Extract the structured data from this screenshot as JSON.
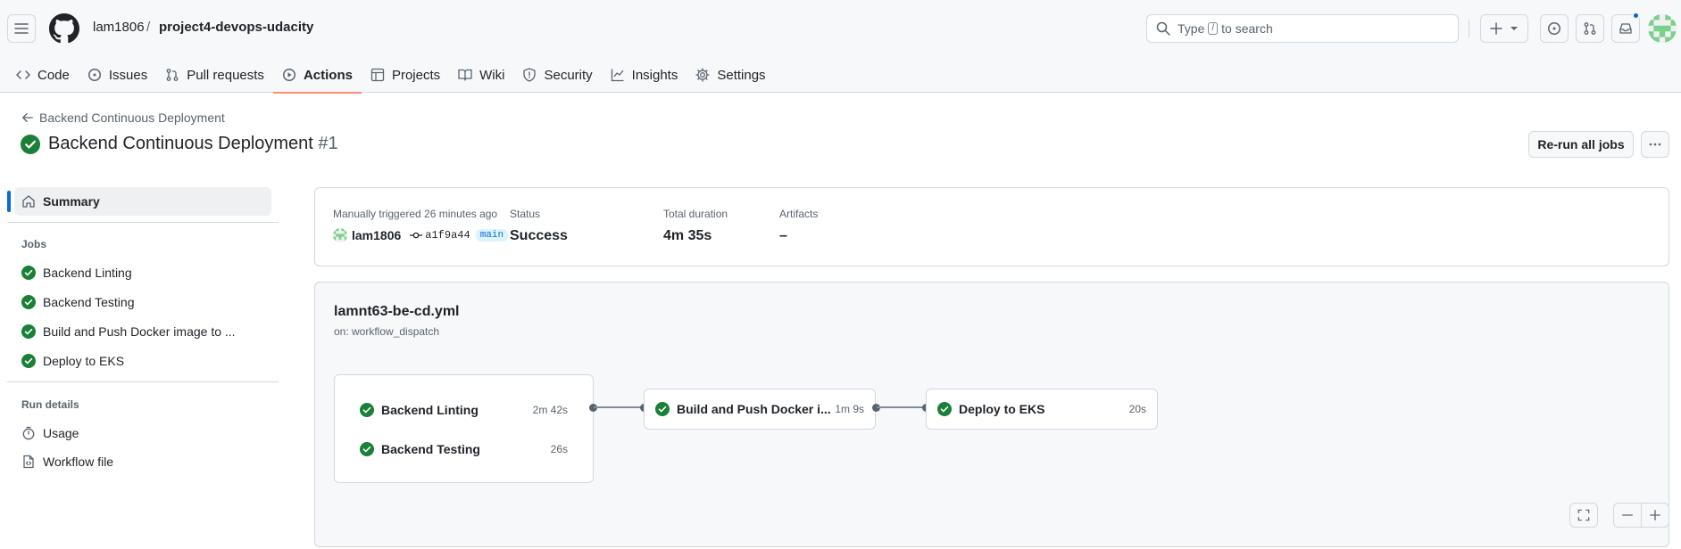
{
  "header": {
    "owner": "lam1806",
    "separator": "/",
    "repo": "project4-devops-udacity",
    "search_prefix": "Type",
    "search_key": "/",
    "search_suffix": "to search"
  },
  "tabs": [
    {
      "label": "Code",
      "icon": "code-icon"
    },
    {
      "label": "Issues",
      "icon": "issue-icon"
    },
    {
      "label": "Pull requests",
      "icon": "pull-request-icon"
    },
    {
      "label": "Actions",
      "icon": "play-icon",
      "active": true
    },
    {
      "label": "Projects",
      "icon": "table-icon"
    },
    {
      "label": "Wiki",
      "icon": "book-icon"
    },
    {
      "label": "Security",
      "icon": "shield-icon"
    },
    {
      "label": "Insights",
      "icon": "graph-icon"
    },
    {
      "label": "Settings",
      "icon": "gear-icon"
    }
  ],
  "run": {
    "back_label": "Backend Continuous Deployment",
    "title": "Backend Continuous Deployment",
    "number": "#1",
    "rerun_label": "Re-run all jobs"
  },
  "sidebar": {
    "summary_label": "Summary",
    "jobs_heading": "Jobs",
    "jobs": [
      {
        "label": "Backend Linting"
      },
      {
        "label": "Backend Testing"
      },
      {
        "label": "Build and Push Docker image to ..."
      },
      {
        "label": "Deploy to EKS"
      }
    ],
    "run_details_heading": "Run details",
    "usage_label": "Usage",
    "workflow_file_label": "Workflow file"
  },
  "summary": {
    "trigger_label": "Manually triggered 26 minutes ago",
    "trigger_user": "lam1806",
    "commit_sha": "a1f9a44",
    "branch": "main",
    "status_label": "Status",
    "status_value": "Success",
    "duration_label": "Total duration",
    "duration_value": "4m 35s",
    "artifacts_label": "Artifacts",
    "artifacts_value": "–"
  },
  "workflow": {
    "file": "lamnt63-be-cd.yml",
    "trigger": "on: workflow_dispatch",
    "jobs": [
      {
        "name": "Backend Linting",
        "duration": "2m 42s"
      },
      {
        "name": "Backend Testing",
        "duration": "26s"
      },
      {
        "name": "Build and Push Docker i...",
        "duration": "1m 9s"
      },
      {
        "name": "Deploy to EKS",
        "duration": "20s"
      }
    ]
  },
  "colors": {
    "success": "#1a7f37",
    "accent_tab": "#fd8c73",
    "link": "#0969da"
  }
}
